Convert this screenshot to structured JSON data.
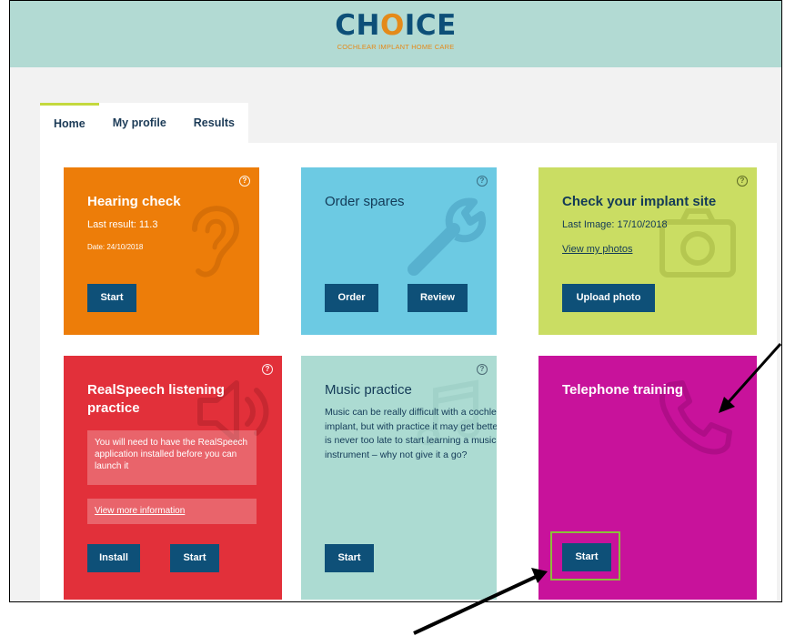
{
  "header": {
    "logo_text_before": "CH",
    "logo_text_o": "O",
    "logo_text_after": "ICE",
    "logo_subtitle": "COCHLEAR IMPLANT HOME CARE"
  },
  "tabs": [
    {
      "label": "Home",
      "active": true
    },
    {
      "label": "My profile",
      "active": false
    },
    {
      "label": "Results",
      "active": false
    }
  ],
  "tiles": {
    "hearing": {
      "title": "Hearing check",
      "last_result": "Last result: 11.3",
      "date": "Date: 24/10/2018",
      "start": "Start",
      "help": "?",
      "color": "#ed7d09",
      "icon": "ear-icon"
    },
    "spares": {
      "title": "Order spares",
      "order": "Order",
      "review": "Review",
      "help": "?",
      "color": "#6ccae3",
      "icon": "wrench-icon"
    },
    "implant": {
      "title": "Check your implant site",
      "last_image": "Last Image: 17/10/2018",
      "view_photos": "View my photos",
      "upload": "Upload photo",
      "help": "?",
      "color": "#cadd63",
      "icon": "camera-icon"
    },
    "realspeech": {
      "title_line1": "RealSpeech listening",
      "title_line2": "practice",
      "info": "You will need to have the RealSpeech application installed before you can launch it",
      "more_info": "View more information",
      "install": "Install",
      "start": "Start",
      "help": "?",
      "color": "#e2303a",
      "icon": "speaker-icon"
    },
    "music": {
      "title": "Music practice",
      "text": "Music can be really difficult with a cochlear implant, but with practice it may get better. It is never too late to start learning a musical instrument – why not give it a go?",
      "start": "Start",
      "help": "?",
      "color": "#acdbd2",
      "icon": "music-note-icon"
    },
    "telephone": {
      "title": "Telephone training",
      "start": "Start",
      "color": "#c8129b",
      "icon": "phone-icon"
    }
  }
}
